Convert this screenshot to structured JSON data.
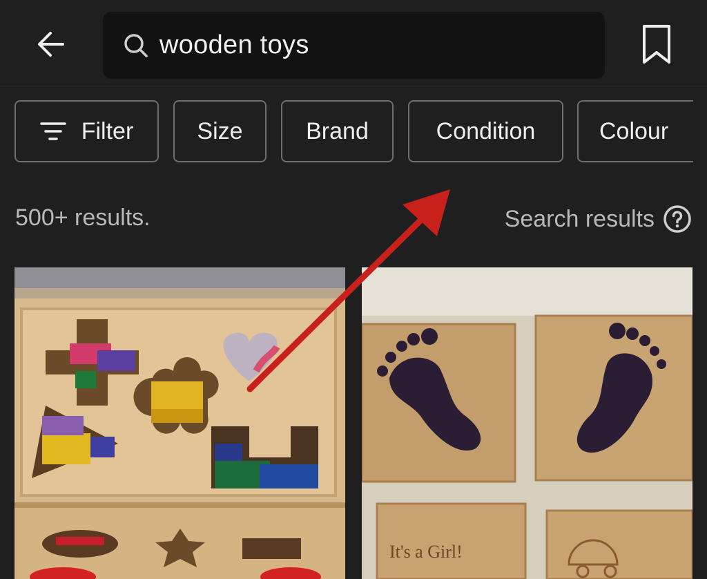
{
  "search": {
    "query": "wooden toys"
  },
  "filters": [
    {
      "label": "Filter"
    },
    {
      "label": "Size"
    },
    {
      "label": "Brand"
    },
    {
      "label": "Condition"
    },
    {
      "label": "Colour"
    }
  ],
  "results": {
    "count": "500+ results.",
    "label": "Search results"
  },
  "listings": [
    {
      "image": "wooden shape sorter box"
    },
    {
      "image": "baby footprint rubber stamps",
      "stamp_text": "It's a Girl!"
    }
  ],
  "icons": {
    "back": "arrow-left-icon",
    "search": "search-icon",
    "bookmark": "bookmark-icon",
    "filter": "filter-icon",
    "help": "help-circle-icon"
  },
  "colors": {
    "background": "#1f1f1f",
    "search_bg": "#121212",
    "annotation_arrow": "#c8201a"
  }
}
